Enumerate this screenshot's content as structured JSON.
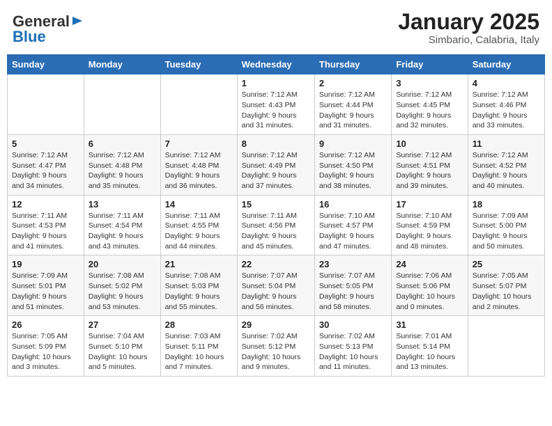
{
  "header": {
    "logo_general": "General",
    "logo_blue": "Blue",
    "month_title": "January 2025",
    "subtitle": "Simbario, Calabria, Italy"
  },
  "days_of_week": [
    "Sunday",
    "Monday",
    "Tuesday",
    "Wednesday",
    "Thursday",
    "Friday",
    "Saturday"
  ],
  "weeks": [
    [
      {
        "day": "",
        "info": ""
      },
      {
        "day": "",
        "info": ""
      },
      {
        "day": "",
        "info": ""
      },
      {
        "day": "1",
        "info": "Sunrise: 7:12 AM\nSunset: 4:43 PM\nDaylight: 9 hours and 31 minutes."
      },
      {
        "day": "2",
        "info": "Sunrise: 7:12 AM\nSunset: 4:44 PM\nDaylight: 9 hours and 31 minutes."
      },
      {
        "day": "3",
        "info": "Sunrise: 7:12 AM\nSunset: 4:45 PM\nDaylight: 9 hours and 32 minutes."
      },
      {
        "day": "4",
        "info": "Sunrise: 7:12 AM\nSunset: 4:46 PM\nDaylight: 9 hours and 33 minutes."
      }
    ],
    [
      {
        "day": "5",
        "info": "Sunrise: 7:12 AM\nSunset: 4:47 PM\nDaylight: 9 hours and 34 minutes."
      },
      {
        "day": "6",
        "info": "Sunrise: 7:12 AM\nSunset: 4:48 PM\nDaylight: 9 hours and 35 minutes."
      },
      {
        "day": "7",
        "info": "Sunrise: 7:12 AM\nSunset: 4:48 PM\nDaylight: 9 hours and 36 minutes."
      },
      {
        "day": "8",
        "info": "Sunrise: 7:12 AM\nSunset: 4:49 PM\nDaylight: 9 hours and 37 minutes."
      },
      {
        "day": "9",
        "info": "Sunrise: 7:12 AM\nSunset: 4:50 PM\nDaylight: 9 hours and 38 minutes."
      },
      {
        "day": "10",
        "info": "Sunrise: 7:12 AM\nSunset: 4:51 PM\nDaylight: 9 hours and 39 minutes."
      },
      {
        "day": "11",
        "info": "Sunrise: 7:12 AM\nSunset: 4:52 PM\nDaylight: 9 hours and 40 minutes."
      }
    ],
    [
      {
        "day": "12",
        "info": "Sunrise: 7:11 AM\nSunset: 4:53 PM\nDaylight: 9 hours and 41 minutes."
      },
      {
        "day": "13",
        "info": "Sunrise: 7:11 AM\nSunset: 4:54 PM\nDaylight: 9 hours and 43 minutes."
      },
      {
        "day": "14",
        "info": "Sunrise: 7:11 AM\nSunset: 4:55 PM\nDaylight: 9 hours and 44 minutes."
      },
      {
        "day": "15",
        "info": "Sunrise: 7:11 AM\nSunset: 4:56 PM\nDaylight: 9 hours and 45 minutes."
      },
      {
        "day": "16",
        "info": "Sunrise: 7:10 AM\nSunset: 4:57 PM\nDaylight: 9 hours and 47 minutes."
      },
      {
        "day": "17",
        "info": "Sunrise: 7:10 AM\nSunset: 4:59 PM\nDaylight: 9 hours and 48 minutes."
      },
      {
        "day": "18",
        "info": "Sunrise: 7:09 AM\nSunset: 5:00 PM\nDaylight: 9 hours and 50 minutes."
      }
    ],
    [
      {
        "day": "19",
        "info": "Sunrise: 7:09 AM\nSunset: 5:01 PM\nDaylight: 9 hours and 51 minutes."
      },
      {
        "day": "20",
        "info": "Sunrise: 7:08 AM\nSunset: 5:02 PM\nDaylight: 9 hours and 53 minutes."
      },
      {
        "day": "21",
        "info": "Sunrise: 7:08 AM\nSunset: 5:03 PM\nDaylight: 9 hours and 55 minutes."
      },
      {
        "day": "22",
        "info": "Sunrise: 7:07 AM\nSunset: 5:04 PM\nDaylight: 9 hours and 56 minutes."
      },
      {
        "day": "23",
        "info": "Sunrise: 7:07 AM\nSunset: 5:05 PM\nDaylight: 9 hours and 58 minutes."
      },
      {
        "day": "24",
        "info": "Sunrise: 7:06 AM\nSunset: 5:06 PM\nDaylight: 10 hours and 0 minutes."
      },
      {
        "day": "25",
        "info": "Sunrise: 7:05 AM\nSunset: 5:07 PM\nDaylight: 10 hours and 2 minutes."
      }
    ],
    [
      {
        "day": "26",
        "info": "Sunrise: 7:05 AM\nSunset: 5:09 PM\nDaylight: 10 hours and 3 minutes."
      },
      {
        "day": "27",
        "info": "Sunrise: 7:04 AM\nSunset: 5:10 PM\nDaylight: 10 hours and 5 minutes."
      },
      {
        "day": "28",
        "info": "Sunrise: 7:03 AM\nSunset: 5:11 PM\nDaylight: 10 hours and 7 minutes."
      },
      {
        "day": "29",
        "info": "Sunrise: 7:02 AM\nSunset: 5:12 PM\nDaylight: 10 hours and 9 minutes."
      },
      {
        "day": "30",
        "info": "Sunrise: 7:02 AM\nSunset: 5:13 PM\nDaylight: 10 hours and 11 minutes."
      },
      {
        "day": "31",
        "info": "Sunrise: 7:01 AM\nSunset: 5:14 PM\nDaylight: 10 hours and 13 minutes."
      },
      {
        "day": "",
        "info": ""
      }
    ]
  ]
}
